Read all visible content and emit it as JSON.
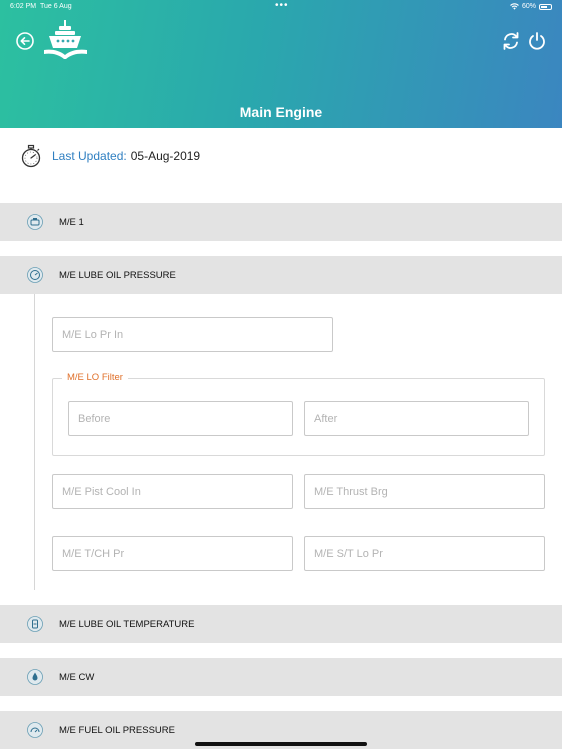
{
  "status": {
    "time": "6:02 PM",
    "date": "Tue 6 Aug",
    "dots": "•••",
    "battery": "60%"
  },
  "header": {
    "title": "Main Engine"
  },
  "icons": {
    "back": "back-arrow-icon",
    "logo": "ship-book-logo",
    "sync": "sync-icon",
    "power": "power-icon",
    "stopwatch": "stopwatch-icon"
  },
  "updated": {
    "label": "Last Updated:",
    "value": "05-Aug-2019"
  },
  "sections": [
    {
      "label": "M/E 1",
      "icon": "engine-icon"
    },
    {
      "label": "M/E LUBE OIL PRESSURE",
      "icon": "gauge-icon"
    },
    {
      "label": "M/E LUBE OIL TEMPERATURE",
      "icon": "oil-can-icon"
    },
    {
      "label": "M/E CW",
      "icon": "water-drop-icon"
    },
    {
      "label": "M/E FUEL OIL PRESSURE",
      "icon": "fuel-gauge-icon"
    }
  ],
  "form": {
    "lo_pr_in": "M/E Lo Pr In",
    "filter_legend": "M/E LO Filter",
    "before": "Before",
    "after": "After",
    "pist_cool_in": "M/E Pist Cool In",
    "thrust_brg": "M/E Thrust Brg",
    "tch_pr": "M/E T/CH Pr",
    "st_lo_pr": "M/E S/T Lo Pr"
  },
  "colors": {
    "accent_blue": "#2f7fc1",
    "legend_orange": "#e0702a",
    "header_start": "#2cc0a0",
    "header_end": "#3b86c0"
  }
}
